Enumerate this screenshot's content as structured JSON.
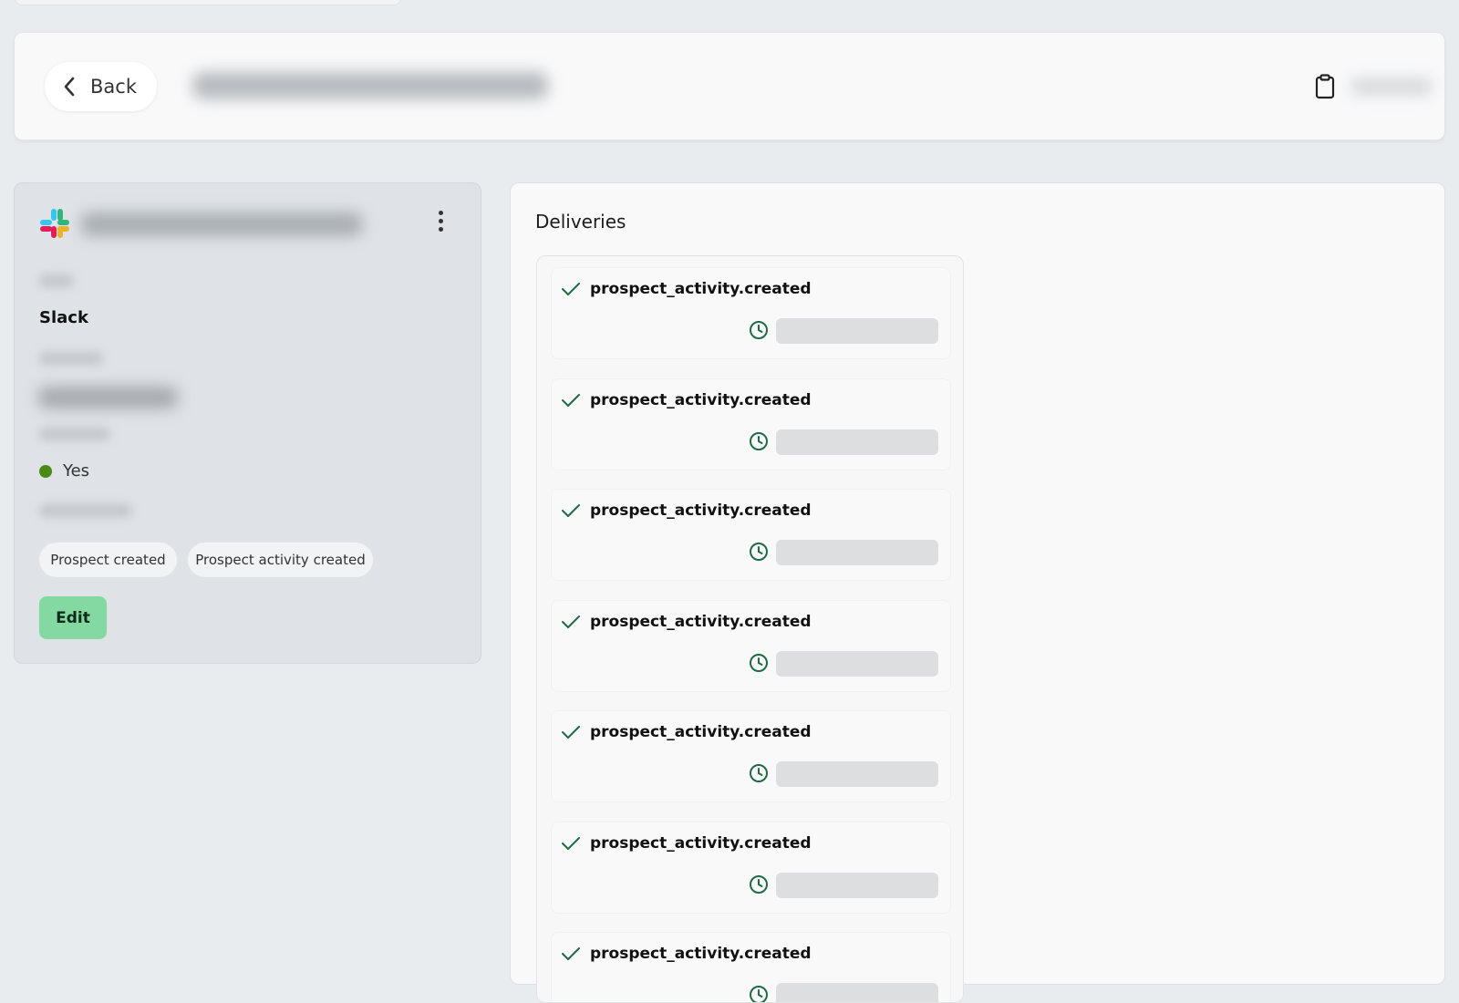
{
  "header": {
    "back_label": "Back",
    "icons": {
      "back": "chevron-left-icon",
      "clipboard": "clipboard-icon"
    }
  },
  "integration": {
    "type_value": "Slack",
    "status_value": "Yes",
    "status_color": "#4b8b15",
    "events": [
      "Prospect created",
      "Prospect activity created"
    ],
    "edit_label": "Edit",
    "icons": {
      "logo": "slack-logo-icon",
      "menu": "kebab-menu-icon"
    }
  },
  "deliveries": {
    "title": "Deliveries",
    "items": [
      {
        "event": "prospect_activity.created"
      },
      {
        "event": "prospect_activity.created"
      },
      {
        "event": "prospect_activity.created"
      },
      {
        "event": "prospect_activity.created"
      },
      {
        "event": "prospect_activity.created"
      },
      {
        "event": "prospect_activity.created"
      },
      {
        "event": "prospect_activity.created"
      }
    ],
    "icons": {
      "success": "check-icon",
      "time": "clock-icon"
    },
    "accent_color": "#1f6b45"
  }
}
